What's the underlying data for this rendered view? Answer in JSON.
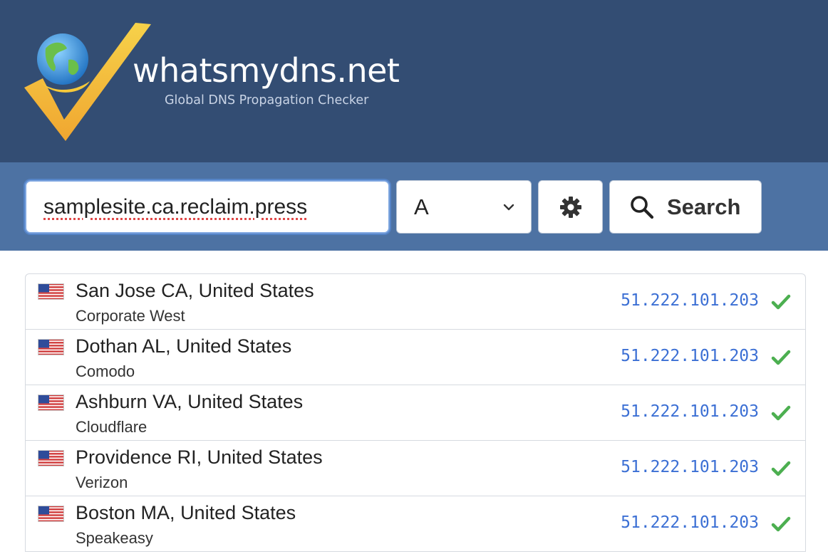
{
  "brand": {
    "name": "whatsmydns.net",
    "tagline": "Global DNS Propagation Checker"
  },
  "search": {
    "domain_value": "samplesite.ca.reclaim.press",
    "record_type": "A",
    "settings_icon": "gear-icon",
    "button_label": "Search",
    "button_icon": "search-icon"
  },
  "colors": {
    "header_bg": "#334d73",
    "searchbar_bg": "#4d72a3",
    "ip_text": "#3b6fd4",
    "success": "#4caf50"
  },
  "results": [
    {
      "location": "San Jose CA, United States",
      "provider": "Corporate West",
      "ip": "51.222.101.203",
      "status": "success",
      "flag": "us-flag-icon"
    },
    {
      "location": "Dothan AL, United States",
      "provider": "Comodo",
      "ip": "51.222.101.203",
      "status": "success",
      "flag": "us-flag-icon"
    },
    {
      "location": "Ashburn VA, United States",
      "provider": "Cloudflare",
      "ip": "51.222.101.203",
      "status": "success",
      "flag": "us-flag-icon"
    },
    {
      "location": "Providence RI, United States",
      "provider": "Verizon",
      "ip": "51.222.101.203",
      "status": "success",
      "flag": "us-flag-icon"
    },
    {
      "location": "Boston MA, United States",
      "provider": "Speakeasy",
      "ip": "51.222.101.203",
      "status": "success",
      "flag": "us-flag-icon"
    }
  ]
}
